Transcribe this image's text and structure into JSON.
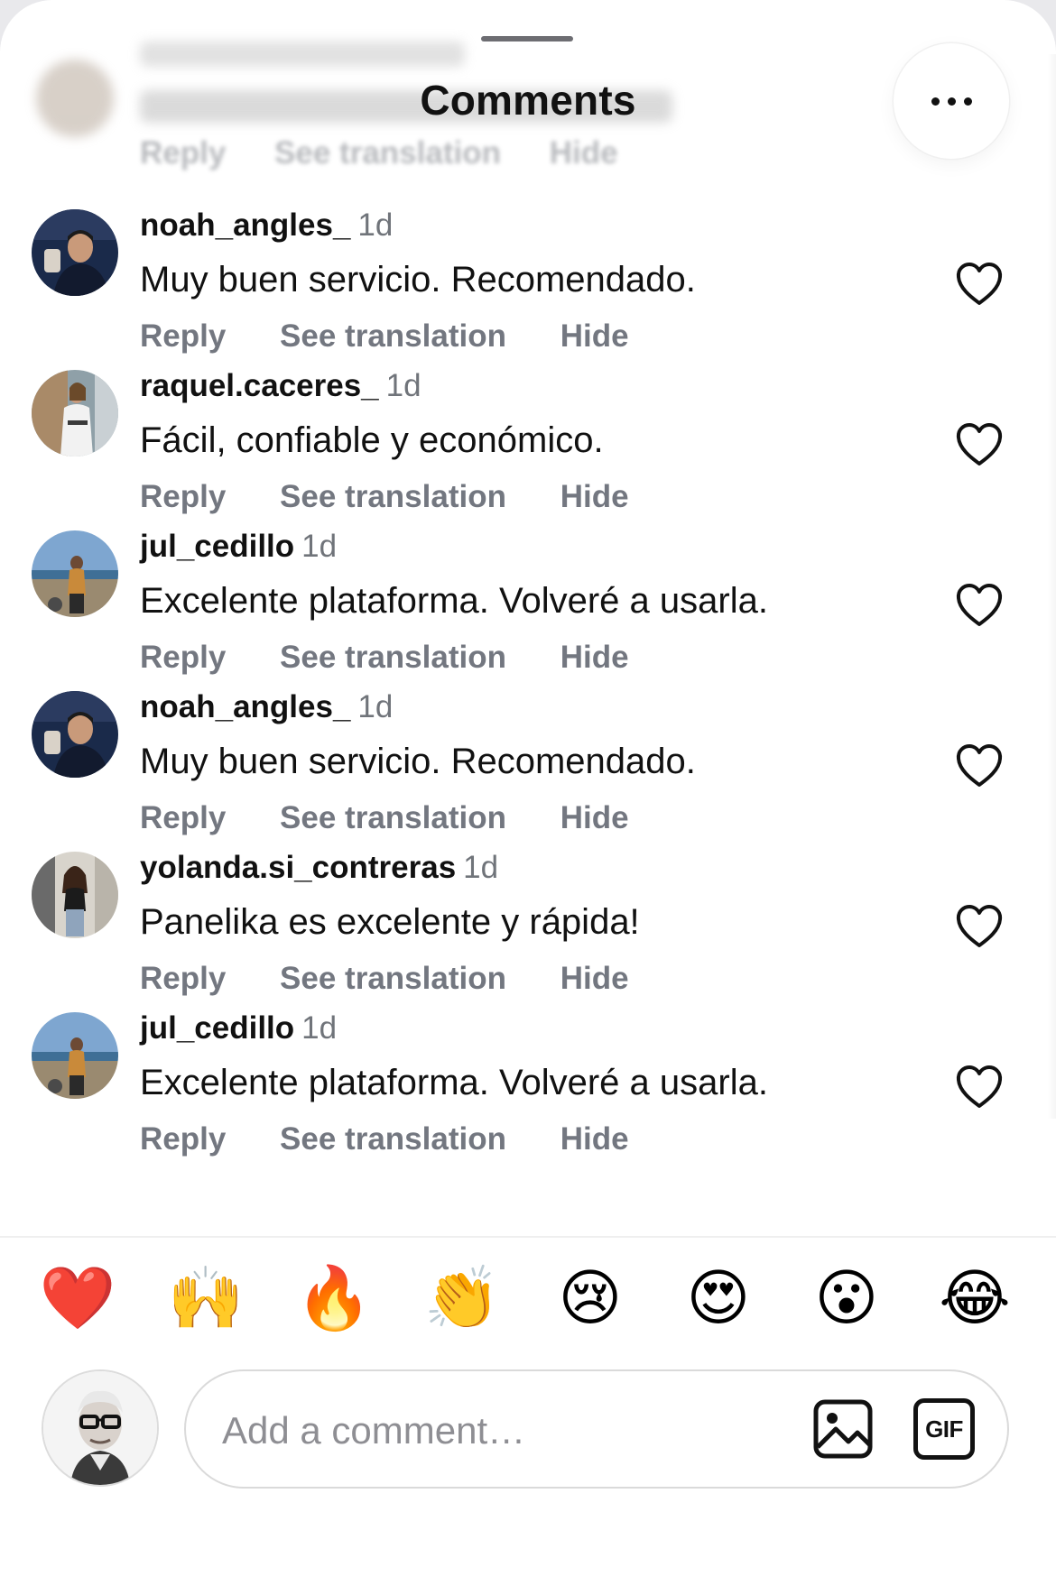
{
  "header": {
    "title": "Comments",
    "more_icon": "more-horizontal-icon"
  },
  "faded_actions": {
    "reply": "Reply",
    "see_translation": "See translation",
    "hide": "Hide"
  },
  "comments": [
    {
      "username": "noah_angles_",
      "time": "1d",
      "text": "Muy buen servicio. Recomendado.",
      "reply": "Reply",
      "see_translation": "See translation",
      "hide": "Hide",
      "like_icon": "heart-outline-icon"
    },
    {
      "username": "raquel.caceres_",
      "time": "1d",
      "text": "Fácil, confiable y económico.",
      "reply": "Reply",
      "see_translation": "See translation",
      "hide": "Hide",
      "like_icon": "heart-outline-icon"
    },
    {
      "username": "jul_cedillo",
      "time": "1d",
      "text": "Excelente plataforma. Volveré a usarla.",
      "reply": "Reply",
      "see_translation": "See translation",
      "hide": "Hide",
      "like_icon": "heart-outline-icon"
    },
    {
      "username": "noah_angles_",
      "time": "1d",
      "text": "Muy buen servicio. Recomendado.",
      "reply": "Reply",
      "see_translation": "See translation",
      "hide": "Hide",
      "like_icon": "heart-outline-icon"
    },
    {
      "username": "yolanda.si_contreras",
      "time": "1d",
      "text": "Panelika es excelente y rápida!",
      "reply": "Reply",
      "see_translation": "See translation",
      "hide": "Hide",
      "like_icon": "heart-outline-icon"
    },
    {
      "username": "jul_cedillo",
      "time": "1d",
      "text": "Excelente plataforma. Volveré a usarla.",
      "reply": "Reply",
      "see_translation": "See translation",
      "hide": "Hide",
      "like_icon": "heart-outline-icon"
    }
  ],
  "reactions": [
    "❤️",
    "🙌",
    "🔥",
    "👏",
    "😢",
    "😍",
    "😮",
    "😂"
  ],
  "composer": {
    "placeholder": "Add a comment…",
    "image_icon": "image-icon",
    "gif_label": "GIF"
  },
  "colors": {
    "text": "#111111",
    "secondary_text": "#737780",
    "background": "#ffffff",
    "heart_stroke": "#111111",
    "reaction_heart": "#e0242a"
  }
}
